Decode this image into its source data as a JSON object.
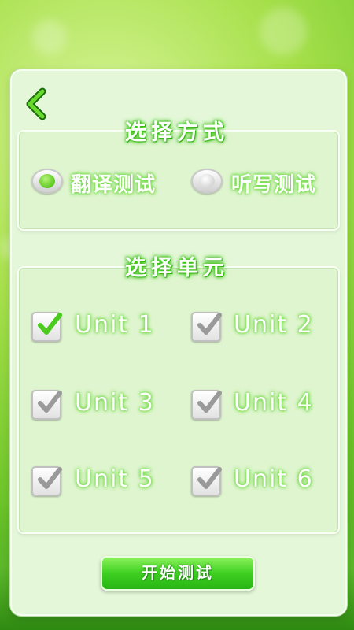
{
  "back": {
    "icon": "chevron-left-icon"
  },
  "mode_section": {
    "title": "选择方式",
    "options": [
      {
        "label": "翻译测试",
        "selected": true
      },
      {
        "label": "听写测试",
        "selected": false
      }
    ]
  },
  "unit_section": {
    "title": "选择单元",
    "units": [
      {
        "label": "Unit 1",
        "checked": true
      },
      {
        "label": "Unit 2",
        "checked": false
      },
      {
        "label": "Unit 3",
        "checked": false
      },
      {
        "label": "Unit 4",
        "checked": false
      },
      {
        "label": "Unit 5",
        "checked": false
      },
      {
        "label": "Unit 6",
        "checked": false
      }
    ]
  },
  "start_button": {
    "label": "开始测试"
  },
  "colors": {
    "accent": "#3fcf22",
    "checked": "#4ccb1f",
    "unchecked": "#9a9a9a"
  }
}
